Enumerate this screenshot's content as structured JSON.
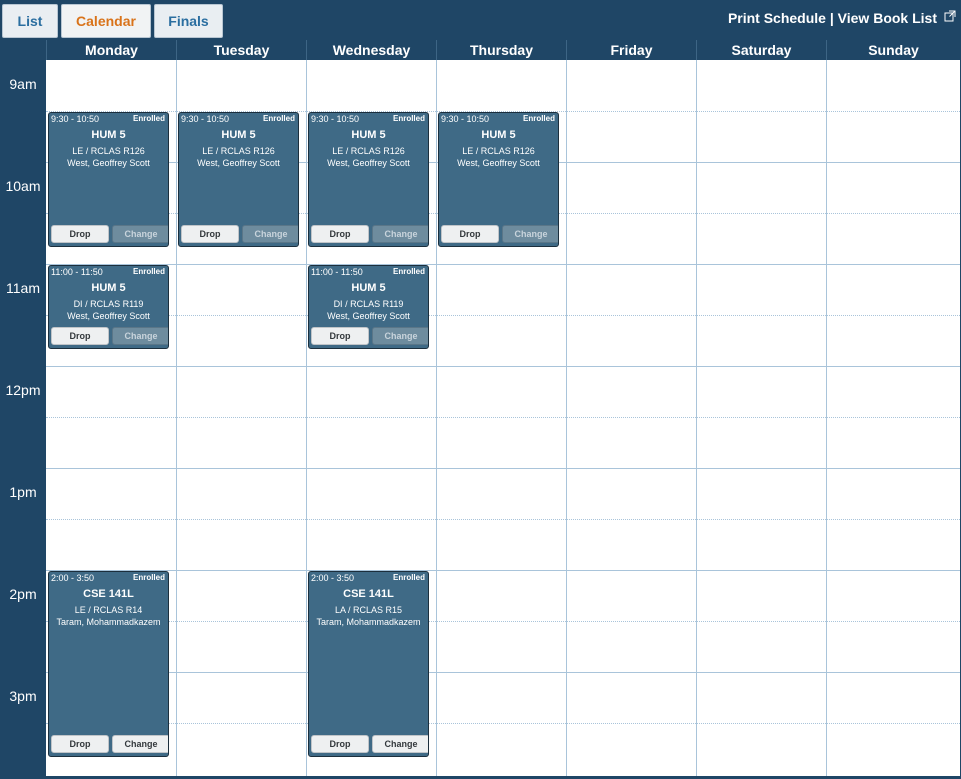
{
  "tabs": [
    "List",
    "Calendar",
    "Finals"
  ],
  "active_tab": "Calendar",
  "header_links": {
    "print": "Print Schedule",
    "separator": "|",
    "books": "View Book List"
  },
  "days": [
    "Monday",
    "Tuesday",
    "Wednesday",
    "Thursday",
    "Friday",
    "Saturday",
    "Sunday"
  ],
  "times": [
    "9am",
    "10am",
    "11am",
    "12pm",
    "1pm",
    "2pm",
    "3pm"
  ],
  "colors": {
    "header": "#1f4666",
    "block": "#3f6a86",
    "active_tab": "#d9731a",
    "tab": "#2a6ea0",
    "grid_line": "#a9c4da"
  },
  "icons": {
    "external_link": "external-link-icon"
  },
  "buttons": {
    "drop": "Drop",
    "change": "Change"
  },
  "events": [
    {
      "day": 0,
      "time": "9:30 - 10:50",
      "status": "Enrolled",
      "course": "HUM 5",
      "location": "LE / RCLAS R126",
      "instructor": "West, Geoffrey Scott",
      "change_enabled": false
    },
    {
      "day": 1,
      "time": "9:30 - 10:50",
      "status": "Enrolled",
      "course": "HUM 5",
      "location": "LE / RCLAS R126",
      "instructor": "West, Geoffrey Scott",
      "change_enabled": false
    },
    {
      "day": 2,
      "time": "9:30 - 10:50",
      "status": "Enrolled",
      "course": "HUM 5",
      "location": "LE / RCLAS R126",
      "instructor": "West, Geoffrey Scott",
      "change_enabled": false
    },
    {
      "day": 3,
      "time": "9:30 - 10:50",
      "status": "Enrolled",
      "course": "HUM 5",
      "location": "LE / RCLAS R126",
      "instructor": "West, Geoffrey Scott",
      "change_enabled": false
    },
    {
      "day": 0,
      "time": "11:00 - 11:50",
      "status": "Enrolled",
      "course": "HUM 5",
      "location": "DI / RCLAS R119",
      "instructor": "West, Geoffrey Scott",
      "change_enabled": false
    },
    {
      "day": 2,
      "time": "11:00 - 11:50",
      "status": "Enrolled",
      "course": "HUM 5",
      "location": "DI / RCLAS R119",
      "instructor": "West, Geoffrey Scott",
      "change_enabled": false
    },
    {
      "day": 0,
      "time": "2:00 - 3:50",
      "status": "Enrolled",
      "course": "CSE 141L",
      "location": "LE / RCLAS R14",
      "instructor": "Taram, Mohammadkazem",
      "change_enabled": true
    },
    {
      "day": 2,
      "time": "2:00 - 3:50",
      "status": "Enrolled",
      "course": "CSE 141L",
      "location": "LA / RCLAS R15",
      "instructor": "Taram, Mohammadkazem",
      "change_enabled": true
    }
  ]
}
